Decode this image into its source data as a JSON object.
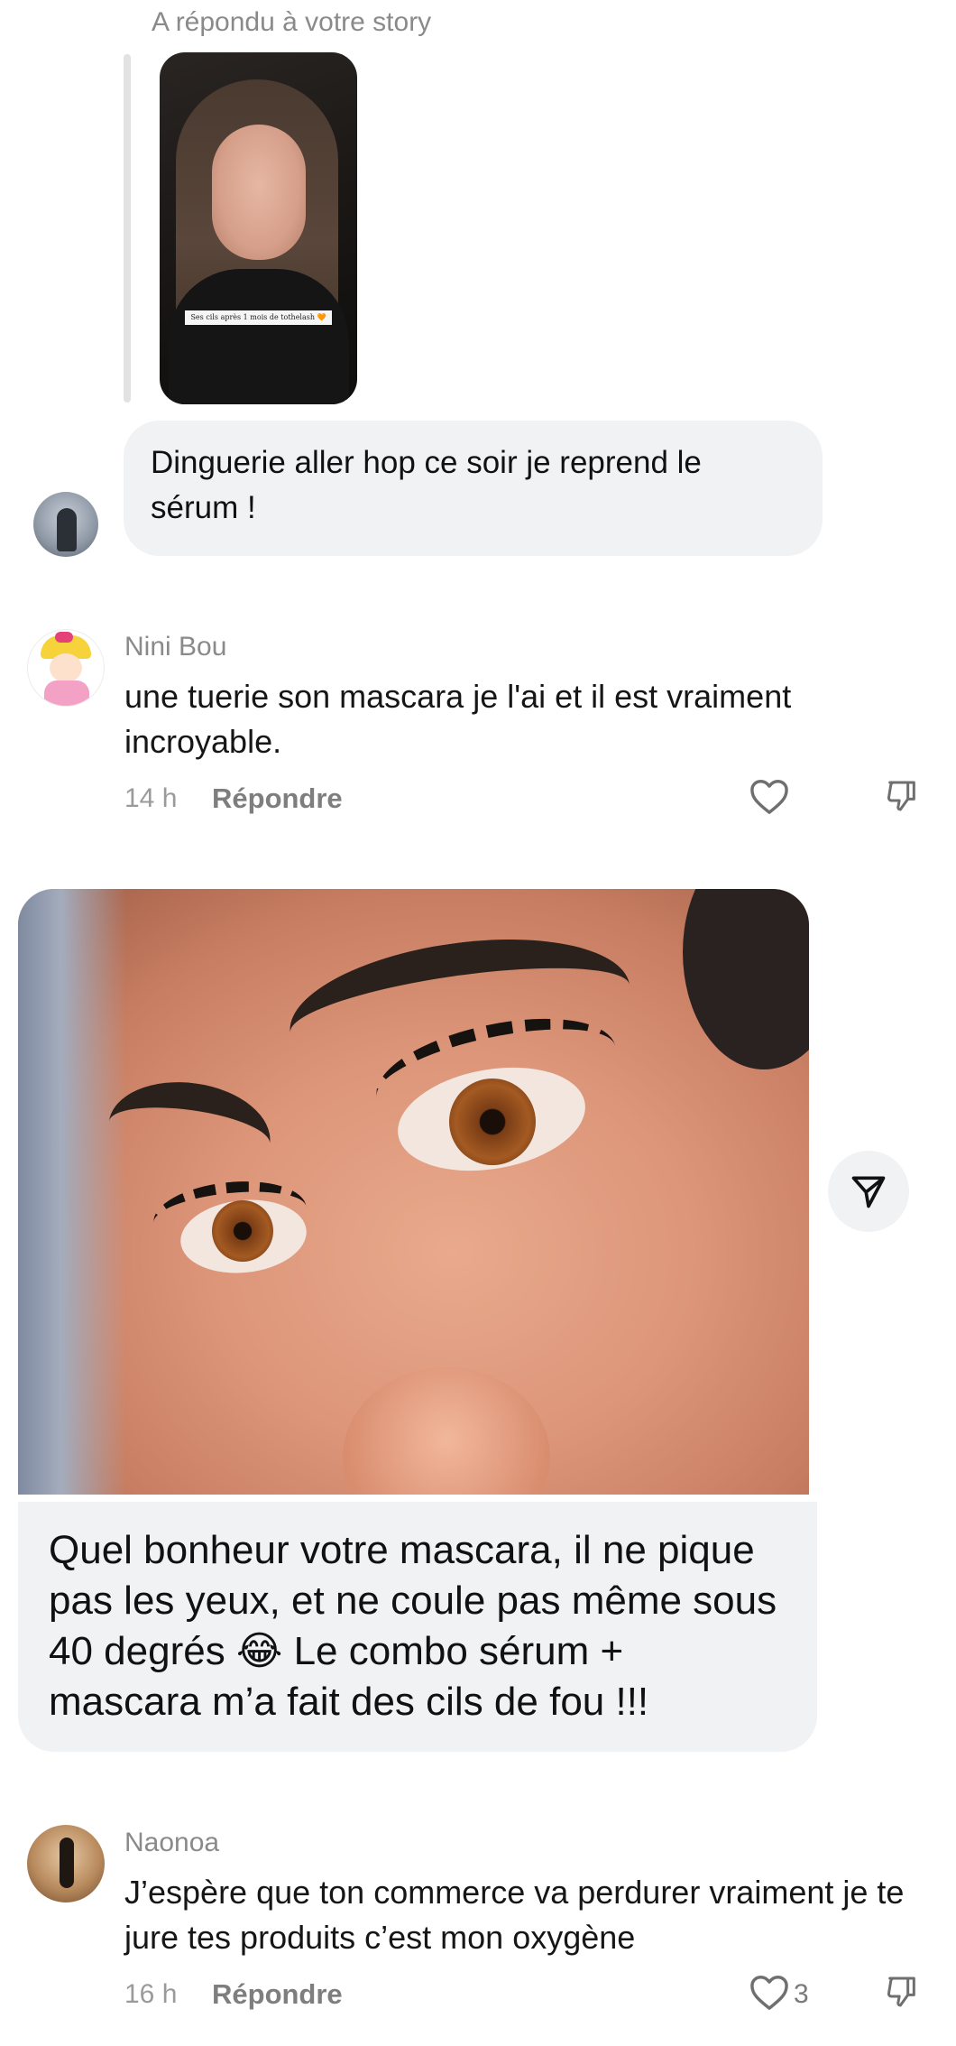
{
  "story_reply": {
    "label": "A répondu à votre story",
    "thumbnail_caption": "Ses cils après 1 mois de tothelash 🧡",
    "message": "Dinguerie aller hop ce soir je reprend le sérum !"
  },
  "comments": [
    {
      "username": "Nini Bou",
      "text": "une tuerie son mascara je l'ai et il est vraiment incroyable.",
      "time": "14 h",
      "reply_label": "Répondre",
      "likes": ""
    },
    {
      "username": "Naonoa",
      "text": "J’espère que ton commerce va perdurer vraiment je te jure tes produits c’est mon oxygène",
      "time": "16 h",
      "reply_label": "Répondre",
      "likes": "3"
    }
  ],
  "photo_message": {
    "text": "Quel bonheur votre mascara, il ne pique pas les yeux, et ne coule pas même sous 40 degrés 😂 Le combo sérum + mascara m’a fait des cils de fou !!!"
  },
  "icons": {
    "like": "heart-outline-icon",
    "dislike": "thumbs-down-icon",
    "share": "paper-plane-icon"
  },
  "colors": {
    "bubble": "#f1f2f4",
    "muted_text": "#8a8a8a",
    "text": "#111111"
  }
}
